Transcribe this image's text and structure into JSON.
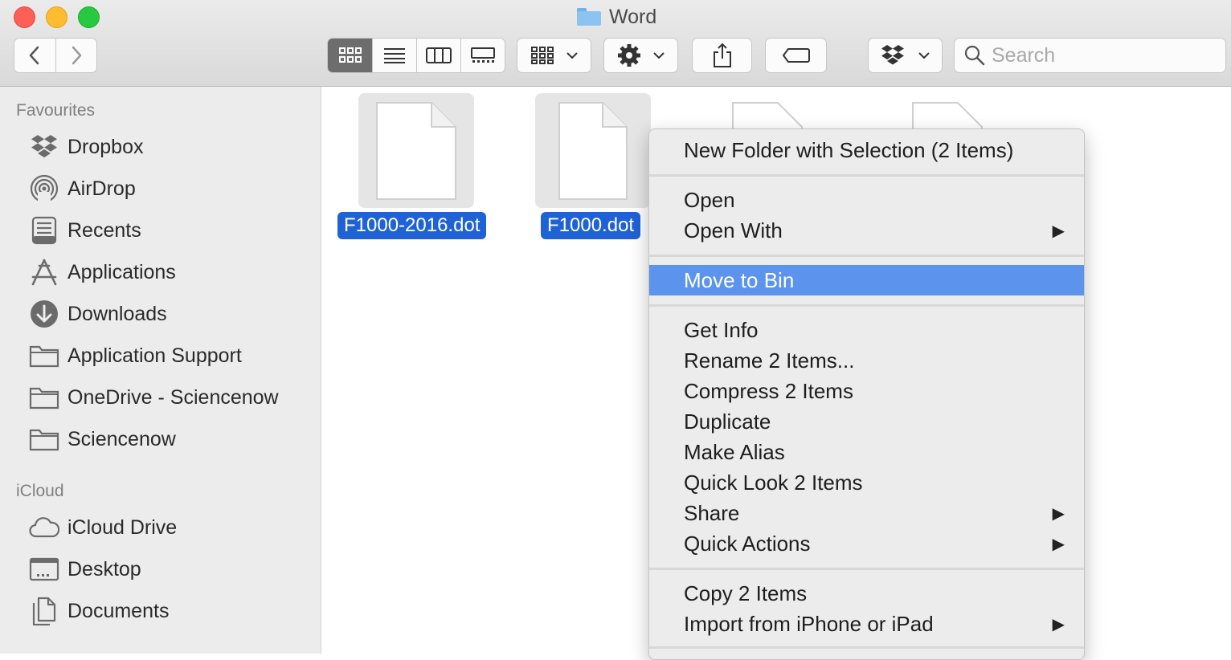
{
  "window": {
    "title": "Word"
  },
  "toolbar": {
    "back_icon": "chevron-left-icon",
    "forward_icon": "chevron-right-icon",
    "search_placeholder": "Search"
  },
  "sidebar": {
    "favourites_title": "Favourites",
    "favourites": [
      {
        "label": "Dropbox",
        "icon": "dropbox-icon"
      },
      {
        "label": "AirDrop",
        "icon": "airdrop-icon"
      },
      {
        "label": "Recents",
        "icon": "recents-icon"
      },
      {
        "label": "Applications",
        "icon": "applications-icon"
      },
      {
        "label": "Downloads",
        "icon": "downloads-icon"
      },
      {
        "label": "Application Support",
        "icon": "folder-icon"
      },
      {
        "label": "OneDrive - Sciencenow",
        "icon": "folder-icon"
      },
      {
        "label": "Sciencenow",
        "icon": "folder-icon"
      }
    ],
    "icloud_title": "iCloud",
    "icloud": [
      {
        "label": "iCloud Drive",
        "icon": "cloud-icon"
      },
      {
        "label": "Desktop",
        "icon": "desktop-icon"
      },
      {
        "label": "Documents",
        "icon": "documents-icon"
      }
    ]
  },
  "files": [
    {
      "name": "F1000-2016.dot",
      "selected": true
    },
    {
      "name": "F1000.dot",
      "selected": true
    }
  ],
  "context_menu": {
    "new_folder": "New Folder with Selection (2 Items)",
    "open": "Open",
    "open_with": "Open With",
    "move_to_bin": "Move to Bin",
    "get_info": "Get Info",
    "rename": "Rename 2 Items...",
    "compress": "Compress 2 Items",
    "duplicate": "Duplicate",
    "make_alias": "Make Alias",
    "quick_look": "Quick Look 2 Items",
    "share": "Share",
    "quick_actions": "Quick Actions",
    "copy": "Copy 2 Items",
    "import_iphone": "Import from iPhone or iPad",
    "submenu_arrow": "▶"
  },
  "colors": {
    "selection": "#1f62d6",
    "menu_highlight": "#5c93ec"
  }
}
